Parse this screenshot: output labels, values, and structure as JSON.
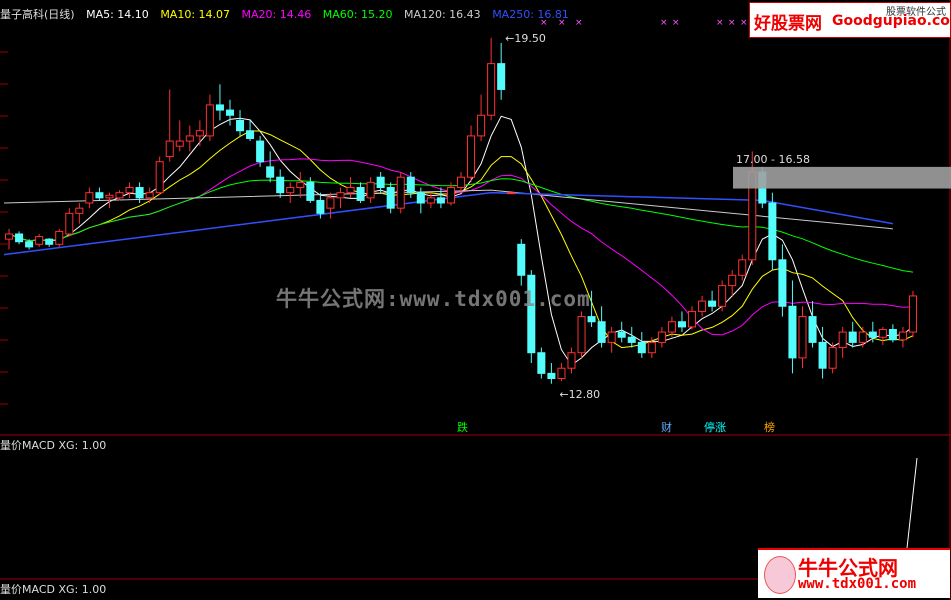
{
  "legend": {
    "title": "量子高科(日线)",
    "items": [
      {
        "label": "MA5: 14.10",
        "color": "#ffffff"
      },
      {
        "label": "MA10: 14.07",
        "color": "#ffff00"
      },
      {
        "label": "MA20: 14.46",
        "color": "#ff00ff"
      },
      {
        "label": "MA60: 15.20",
        "color": "#00ff00"
      },
      {
        "label": "MA120: 16.43",
        "color": "#cccccc"
      },
      {
        "label": "MA250: 16.81",
        "color": "#3050ff"
      }
    ]
  },
  "logo_top": {
    "cn": "好股票网",
    "en": "Goodgupiao.com",
    "sub": "股票软件公式"
  },
  "watermark": "牛牛公式网:www.tdx001.com",
  "logo_bottom": {
    "cn": "牛牛公式网",
    "en": "www.tdx001.com"
  },
  "indicator_title_1": "量价MACD XG: 1.00",
  "indicator_title_2": "量价MACD XG: 1.00",
  "chart_data": {
    "type": "candlestick",
    "price_range": [
      12.0,
      20.0
    ],
    "annotations": {
      "high": "19.50",
      "low": "12.80",
      "band": "17.00 - 16.58",
      "markers": [
        "跌",
        "财",
        "停涨",
        "榜"
      ]
    },
    "colors": {
      "up": "#ff3030",
      "down": "#54fcfc",
      "axis": "#a00000"
    },
    "candles": [
      [
        15.6,
        15.8,
        15.4,
        15.7
      ],
      [
        15.7,
        15.75,
        15.5,
        15.55
      ],
      [
        15.55,
        15.6,
        15.4,
        15.45
      ],
      [
        15.5,
        15.7,
        15.45,
        15.65
      ],
      [
        15.6,
        15.62,
        15.45,
        15.5
      ],
      [
        15.5,
        15.8,
        15.45,
        15.75
      ],
      [
        15.7,
        16.2,
        15.65,
        16.1
      ],
      [
        16.1,
        16.3,
        15.9,
        16.2
      ],
      [
        16.3,
        16.6,
        16.2,
        16.5
      ],
      [
        16.5,
        16.6,
        16.35,
        16.4
      ],
      [
        16.4,
        16.5,
        16.2,
        16.45
      ],
      [
        16.4,
        16.55,
        16.35,
        16.5
      ],
      [
        16.5,
        16.7,
        16.4,
        16.6
      ],
      [
        16.6,
        16.7,
        16.3,
        16.4
      ],
      [
        16.4,
        16.6,
        16.3,
        16.5
      ],
      [
        16.5,
        17.2,
        16.45,
        17.1
      ],
      [
        17.2,
        18.5,
        17.1,
        17.5
      ],
      [
        17.4,
        17.9,
        17.3,
        17.5
      ],
      [
        17.5,
        17.8,
        17.3,
        17.6
      ],
      [
        17.6,
        17.9,
        17.4,
        17.7
      ],
      [
        17.6,
        18.4,
        17.5,
        18.2
      ],
      [
        18.2,
        18.6,
        17.9,
        18.1
      ],
      [
        18.1,
        18.3,
        17.8,
        18.0
      ],
      [
        17.9,
        18.1,
        17.6,
        17.7
      ],
      [
        17.7,
        17.9,
        17.5,
        17.55
      ],
      [
        17.5,
        17.6,
        17.0,
        17.1
      ],
      [
        17.0,
        17.3,
        16.7,
        16.8
      ],
      [
        16.8,
        16.95,
        16.4,
        16.5
      ],
      [
        16.5,
        16.7,
        16.3,
        16.6
      ],
      [
        16.6,
        16.9,
        16.4,
        16.7
      ],
      [
        16.7,
        16.8,
        16.3,
        16.35
      ],
      [
        16.35,
        16.5,
        16.0,
        16.1
      ],
      [
        16.2,
        16.5,
        16.0,
        16.4
      ],
      [
        16.4,
        16.6,
        16.2,
        16.5
      ],
      [
        16.5,
        16.8,
        16.4,
        16.6
      ],
      [
        16.6,
        16.7,
        16.3,
        16.35
      ],
      [
        16.4,
        16.8,
        16.3,
        16.7
      ],
      [
        16.8,
        16.9,
        16.5,
        16.6
      ],
      [
        16.6,
        16.7,
        16.1,
        16.2
      ],
      [
        16.2,
        16.9,
        16.1,
        16.8
      ],
      [
        16.8,
        16.9,
        16.4,
        16.5
      ],
      [
        16.5,
        16.6,
        16.1,
        16.3
      ],
      [
        16.3,
        16.5,
        16.2,
        16.4
      ],
      [
        16.4,
        16.6,
        16.2,
        16.3
      ],
      [
        16.3,
        16.7,
        16.25,
        16.6
      ],
      [
        16.6,
        16.9,
        16.5,
        16.8
      ],
      [
        16.8,
        17.8,
        16.7,
        17.6
      ],
      [
        17.6,
        18.4,
        17.5,
        18.0
      ],
      [
        18.0,
        19.5,
        17.9,
        19.0
      ],
      [
        19.0,
        19.4,
        18.3,
        18.5
      ],
      [
        16.5,
        16.5,
        16.5,
        16.5
      ],
      [
        15.5,
        15.6,
        14.7,
        14.9
      ],
      [
        14.9,
        15.0,
        13.2,
        13.4
      ],
      [
        13.4,
        13.5,
        12.9,
        13.0
      ],
      [
        13.0,
        13.2,
        12.8,
        12.9
      ],
      [
        12.9,
        13.2,
        12.85,
        13.1
      ],
      [
        13.1,
        13.5,
        13.0,
        13.4
      ],
      [
        13.4,
        14.2,
        13.3,
        14.1
      ],
      [
        14.1,
        14.6,
        13.9,
        14.0
      ],
      [
        14.0,
        14.3,
        13.5,
        13.6
      ],
      [
        13.6,
        13.9,
        13.4,
        13.8
      ],
      [
        13.8,
        14.0,
        13.6,
        13.7
      ],
      [
        13.7,
        13.9,
        13.5,
        13.6
      ],
      [
        13.6,
        13.8,
        13.3,
        13.4
      ],
      [
        13.4,
        13.7,
        13.3,
        13.6
      ],
      [
        13.6,
        13.9,
        13.5,
        13.8
      ],
      [
        13.8,
        14.1,
        13.7,
        14.0
      ],
      [
        14.0,
        14.2,
        13.8,
        13.9
      ],
      [
        13.9,
        14.3,
        13.85,
        14.2
      ],
      [
        14.2,
        14.5,
        14.1,
        14.4
      ],
      [
        14.4,
        14.6,
        14.2,
        14.3
      ],
      [
        14.3,
        14.8,
        14.2,
        14.7
      ],
      [
        14.7,
        15.0,
        14.5,
        14.9
      ],
      [
        14.9,
        15.3,
        14.8,
        15.2
      ],
      [
        15.2,
        17.3,
        15.1,
        16.9
      ],
      [
        16.9,
        17.0,
        16.2,
        16.3
      ],
      [
        16.3,
        16.5,
        15.0,
        15.2
      ],
      [
        15.2,
        15.5,
        14.1,
        14.3
      ],
      [
        14.3,
        14.8,
        13.0,
        13.3
      ],
      [
        13.3,
        14.3,
        13.1,
        14.1
      ],
      [
        14.1,
        14.4,
        13.5,
        13.6
      ],
      [
        13.6,
        13.9,
        12.9,
        13.1
      ],
      [
        13.1,
        13.6,
        13.0,
        13.5
      ],
      [
        13.5,
        13.9,
        13.3,
        13.8
      ],
      [
        13.8,
        14.0,
        13.5,
        13.6
      ],
      [
        13.6,
        13.9,
        13.5,
        13.8
      ],
      [
        13.8,
        14.0,
        13.6,
        13.7
      ],
      [
        13.7,
        13.9,
        13.55,
        13.85
      ],
      [
        13.85,
        13.95,
        13.6,
        13.65
      ],
      [
        13.65,
        13.9,
        13.5,
        13.8
      ],
      [
        13.8,
        14.6,
        13.7,
        14.5
      ]
    ]
  }
}
